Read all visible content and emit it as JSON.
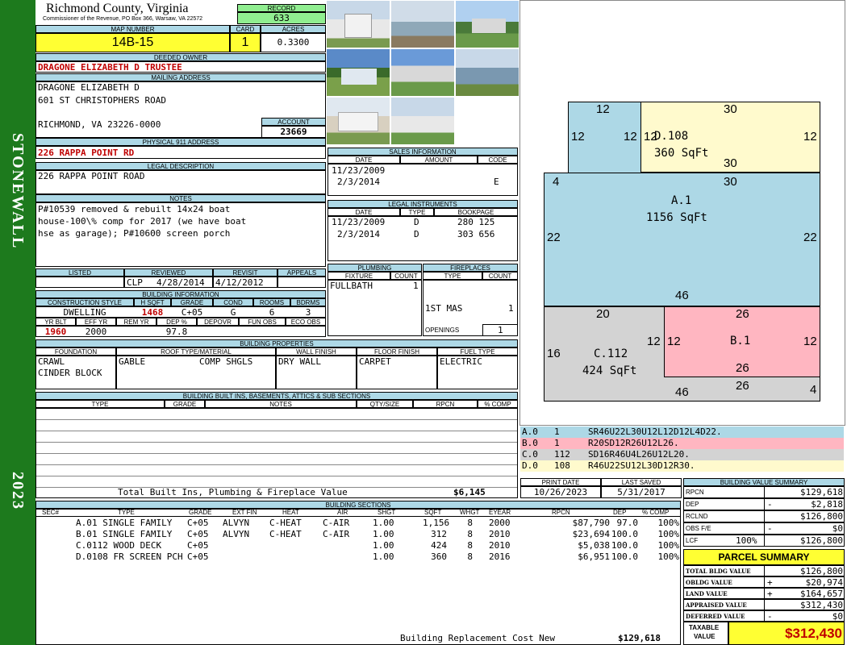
{
  "sidebar": {
    "district": "STONEWALL",
    "year": "2023"
  },
  "header": {
    "county": "Richmond County, Virginia",
    "commissioner": "Commissioner of the Revenue, PO Box 366, Warsaw, VA 22572",
    "record_label": "RECORD",
    "record": "633",
    "map_label": "MAP NUMBER",
    "map": "14B-15",
    "card_label": "CARD",
    "card": "1",
    "acres_label": "ACRES",
    "acres": "0.3300"
  },
  "owner": {
    "deeded_label": "DEEDED OWNER",
    "deeded": "DRAGONE ELIZABETH D TRUSTEE",
    "mailing_label": "MAILING ADDRESS",
    "mail1": "DRAGONE ELIZABETH D",
    "mail2": "601 ST CHRISTOPHERS ROAD",
    "mail3": "RICHMOND, VA 23226-0000",
    "account_label": "ACCOUNT",
    "account": "23669",
    "physical_label": "PHYSICAL 911 ADDRESS",
    "physical": "226 RAPPA POINT RD",
    "legal_label": "LEGAL DESCRIPTION",
    "legal": "226 RAPPA POINT ROAD",
    "notes_label": "NOTES",
    "notes1": "P#10539 removed & rebuilt 14x24 boat",
    "notes2": "house-100\\% comp for 2017 (we have boat",
    "notes3": "hse as garage); P#10600 screen porch"
  },
  "review": {
    "listed_label": "LISTED",
    "reviewed_label": "REVIEWED",
    "revisit_label": "REVISIT",
    "appeals_label": "APPEALS",
    "reviewer": "CLP",
    "reviewed": "4/28/2014",
    "revisit": "4/12/2012"
  },
  "building_info": {
    "title": "BUILDING INFORMATION",
    "labels": {
      "style": "CONSTRUCTION STYLE",
      "hsqft": "H SQFT",
      "grade": "GRADE",
      "cond": "COND",
      "rooms": "ROOMS",
      "bdrms": "BDRMS",
      "yrblt": "YR BLT",
      "effyr": "EFF YR",
      "remyr": "REM YR",
      "dep": "DEP %",
      "depovr": "DEPOVR",
      "funobs": "FUN OBS",
      "ecoobs": "ECO OBS"
    },
    "style": "DWELLING",
    "hsqft": "1468",
    "grade": "C+05",
    "cond": "G",
    "rooms": "6",
    "bdrms": "3",
    "yrblt": "1960",
    "effyr": "2000",
    "dep": "97.8"
  },
  "sales": {
    "title": "SALES INFORMATION",
    "date_label": "DATE",
    "amount_label": "AMOUNT",
    "code_label": "CODE",
    "rows": [
      {
        "date": "11/23/2009",
        "code": ""
      },
      {
        "date": "2/3/2014",
        "code": "E"
      }
    ]
  },
  "legal_instr": {
    "title": "LEGAL INSTRUMENTS",
    "date_label": "DATE",
    "type_label": "TYPE",
    "book_label": "BOOKPAGE",
    "rows": [
      {
        "date": "11/23/2009",
        "type": "D",
        "book": "280 125"
      },
      {
        "date": "2/3/2014",
        "type": "D",
        "book": "303 656"
      }
    ]
  },
  "plumbing": {
    "title": "PLUMBING",
    "fixture_label": "FIXTURE",
    "count_label": "COUNT",
    "fixture": "FULLBATH",
    "count": "1"
  },
  "fireplaces": {
    "title": "FIREPLACES",
    "type_label": "TYPE",
    "count_label": "COUNT",
    "type": "1ST MAS",
    "count": "1",
    "openings_label": "OPENINGS",
    "openings": "1"
  },
  "properties": {
    "title": "BUILDING PROPERTIES",
    "foundation_label": "FOUNDATION",
    "roof_label": "ROOF TYPE/MATERIAL",
    "wall_label": "WALL FINISH",
    "floor_label": "FLOOR FINISH",
    "fuel_label": "FUEL TYPE",
    "foundation1": "CRAWL",
    "foundation2": "CINDER BLOCK",
    "roof_type": "GABLE",
    "roof_mat": "COMP SHGLS",
    "wall": "DRY WALL",
    "floor": "CARPET",
    "fuel": "ELECTRIC"
  },
  "builtins": {
    "title": "BUILDING BUILT INS, BASEMENTS, ATTICS & SUB SECTIONS",
    "type_label": "TYPE",
    "grade_label": "GRADE",
    "notes_label": "NOTES",
    "qty_label": "QTY/SIZE",
    "rpcn_label": "RPCN",
    "comp_label": "% COMP",
    "total_label": "Total Built Ins, Plumbing & Fireplace Value",
    "total": "$6,145"
  },
  "print": {
    "print_label": "PRINT DATE",
    "saved_label": "LAST SAVED",
    "print": "10/26/2023",
    "saved": "5/31/2017"
  },
  "sections": {
    "title": "BUILDING SECTIONS",
    "headers": {
      "sec": "SEC#",
      "type": "TYPE",
      "grade": "GRADE",
      "ext": "EXT FIN",
      "heat": "HEAT",
      "air": "AIR",
      "shgt": "SHGT",
      "sqft": "SQFT",
      "whgt": "WHGT",
      "eyear": "EYEAR",
      "rpcn": "RPCN",
      "dep": "DEP",
      "comp": "% COMP"
    },
    "rows": [
      {
        "sec": "A.0",
        "type": "1 SINGLE FAMILY",
        "grade": "C+05",
        "ext": "ALVYN",
        "heat": "C-HEAT",
        "air": "C-AIR",
        "shgt": "1.00",
        "sqft": "1,156",
        "whgt": "8",
        "eyear": "2000",
        "rpcn": "$87,790",
        "dep": "97.0",
        "comp": "100%"
      },
      {
        "sec": "B.0",
        "type": "1 SINGLE FAMILY",
        "grade": "C+05",
        "ext": "ALVYN",
        "heat": "C-HEAT",
        "air": "C-AIR",
        "shgt": "1.00",
        "sqft": "312",
        "whgt": "8",
        "eyear": "2010",
        "rpcn": "$23,694",
        "dep": "100.0",
        "comp": "100%"
      },
      {
        "sec": "C.0",
        "type": "112 WOOD DECK",
        "grade": "C+05",
        "ext": "",
        "heat": "",
        "air": "",
        "shgt": "1.00",
        "sqft": "424",
        "whgt": "8",
        "eyear": "2010",
        "rpcn": "$5,038",
        "dep": "100.0",
        "comp": "100%"
      },
      {
        "sec": "D.0",
        "type": "108 FR SCREEN PCH",
        "grade": "C+05",
        "ext": "",
        "heat": "",
        "air": "",
        "shgt": "1.00",
        "sqft": "360",
        "whgt": "8",
        "eyear": "2016",
        "rpcn": "$6,951",
        "dep": "100.0",
        "comp": "100%"
      }
    ],
    "replacement_label": "Building Replacement Cost New",
    "replacement": "$129,618"
  },
  "sketch": {
    "colors": {
      "a": "#add8e6",
      "b": "#ffb6c1",
      "c": "#d3d3d3",
      "d": "#fffacd"
    },
    "d_name": "D.108",
    "d_area": "360 SqFt",
    "a_name": "A.1",
    "a_area": "1156 SqFt",
    "b_name": "B.1",
    "c_name": "C.112",
    "c_area": "424 SqFt",
    "dims": {
      "d_top_left": "12",
      "d_top_right": "30",
      "d_left_a": "12",
      "d_left_b": "12",
      "d_right": "12",
      "d_bottom": "30",
      "a_left_top": "4",
      "a_top": "30",
      "a_left": "22",
      "a_right": "22",
      "a_bottom": "46",
      "c_top": "20",
      "c_left": "16",
      "c_right": "12",
      "c_bottom": "46",
      "b_top": "26",
      "b_left": "12",
      "b_right": "12",
      "b_bottom": "26",
      "b_bottom2": "26",
      "b_right_step": "4"
    }
  },
  "legend": [
    {
      "code": "A.0",
      "n": "1",
      "path": "SR46U22L30U12L12D12L4D22."
    },
    {
      "code": "B.0",
      "n": "1",
      "path": "R20SD12R26U12L26."
    },
    {
      "code": "C.0",
      "n": "112",
      "path": "SD16R46U4L26U12L20."
    },
    {
      "code": "D.0",
      "n": "108",
      "path": "R46U22SU12L30D12R30."
    }
  ],
  "value_summary": {
    "title": "BUILDING VALUE SUMMARY",
    "rpcn_label": "RPCN",
    "rpcn": "$129,618",
    "dep_label": "DEP",
    "dep_sign": "-",
    "dep": "$2,818",
    "rclnd_label": "RCLND",
    "rclnd": "$126,800",
    "obs_label": "OBS F/E",
    "obs_sign": "-",
    "obs": "$0",
    "lcf_label": "LCF",
    "lcf_pct": "100%",
    "lcf": "$126,800"
  },
  "parcel": {
    "title": "PARCEL SUMMARY",
    "bldg_label": "TOTAL BLDG VALUE",
    "bldg": "$126,800",
    "obldg_label": "OBLDG VALUE",
    "obldg_sign": "+",
    "obldg": "$20,974",
    "land_label": "LAND VALUE",
    "land_sign": "+",
    "land": "$164,657",
    "appraised_label": "APPRAISED VALUE",
    "appraised": "$312,430",
    "deferred_label": "DEFERRED VALUE",
    "deferred_sign": "-",
    "deferred": "$0",
    "taxable_label1": "TAXABLE",
    "taxable_label2": "VALUE",
    "taxable": "$312,430"
  }
}
